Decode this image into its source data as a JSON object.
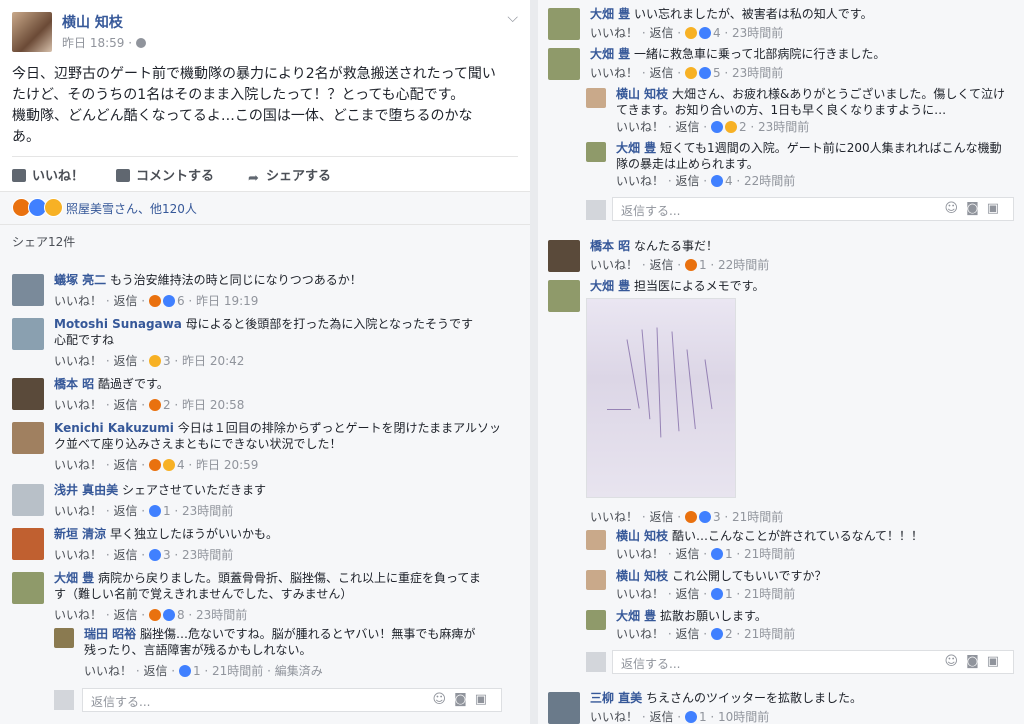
{
  "post": {
    "author": "横山 知枝",
    "time": "昨日 18:59 ·",
    "text_lines": [
      "今日、辺野古のゲート前で機動隊の暴力により2名が救急搬送されたって聞い",
      "たけど、そのうちの1名はそのまま入院したって！？とっても心配です。",
      "機動隊、どんどん酷くなってるよ…この国は一体、どこまで堕ちるのかな",
      "あ。"
    ],
    "like_label": "いいね！",
    "comment_label": "コメントする",
    "share_label": "シェアする",
    "reactions_text": "照屋美雪さん、他120人",
    "shares_text": "シェア12件"
  },
  "colors": {
    "link": "#365899",
    "meta": "#90949c",
    "like": "#4080ff",
    "sad": "#f7b125",
    "angry": "#e9710f"
  },
  "labels": {
    "like": "いいね！",
    "reply": "返信",
    "reply_placeholder": "返信する..."
  },
  "left_comments": [
    {
      "name": "蟻塚 亮二",
      "text": "もう治安維持法の時と同じになりつつあるか！",
      "count": "6",
      "time": "昨日 19:19"
    },
    {
      "name": "Motoshi Sunagawa",
      "text": "母によると後頭部を打った為に入院となったそうです",
      "text2": "心配ですね",
      "count": "3",
      "time": "昨日 20:42"
    },
    {
      "name": "橋本 昭",
      "text": "酷過ぎです。",
      "count": "2",
      "time": "昨日 20:58"
    },
    {
      "name": "Kenichi Kakuzumi",
      "text": "今日は１回目の排除からずっとゲートを閉けたままアルソッ",
      "text2": "ク並べて座り込みさえまともにできない状況でした！",
      "count": "4",
      "time": "昨日 20:59"
    },
    {
      "name": "浅井 真由美",
      "text": "シェアさせていただきます",
      "count": "1",
      "time": "23時間前"
    },
    {
      "name": "新垣 清涼",
      "text": "早く独立したほうがいいかも。",
      "count": "3",
      "time": "23時間前"
    },
    {
      "name": "大畑 豊",
      "text": "病院から戻りました。頭蓋骨骨折、脳挫傷、これ以上に重症を負ってま",
      "text2": "す（難しい名前で覚えきれませんでした、すみません）",
      "count": "8",
      "time": "23時間前"
    }
  ],
  "left_reply": {
    "name": "瑞田 昭裕",
    "text": "脳挫傷…危ないですね。脳が腫れるとヤバい！無事でも麻痺が",
    "text2": "残ったり、言語障害が残るかもしれない。",
    "count": "1",
    "time": "21時間前",
    "edited": "編集済み"
  },
  "right_comments": {
    "c1": {
      "name": "大畑 豊",
      "text": "いい忘れましたが、被害者は私の知人です。",
      "count": "4",
      "time": "23時間前"
    },
    "c2": {
      "name": "大畑 豊",
      "text": "一緒に救急車に乗って北部病院に行きました。",
      "count": "5",
      "time": "23時間前"
    },
    "r1": {
      "name": "横山 知枝",
      "text": "大畑さん、お疲れ様&ありがとうございました。傷しくて泣け",
      "text2": "てきます。お知り合いの方、1日も早く良くなりますように…",
      "count": "2",
      "time": "23時間前"
    },
    "r2": {
      "name": "大畑 豊",
      "text": "短くても1週間の入院。ゲート前に200人集まれればこんな機動",
      "text2": "隊の暴走は止められます。",
      "count": "4",
      "time": "22時間前"
    },
    "c3": {
      "name": "橋本 昭",
      "text": "なんたる事だ！",
      "count": "1",
      "time": "22時間前"
    },
    "c4": {
      "name": "大畑 豊",
      "text": "担当医によるメモです。",
      "count": "3",
      "time": "21時間前"
    },
    "r3": {
      "name": "横山 知枝",
      "text": "酷い…こんなことが許されているなんて！！！",
      "count": "1",
      "time": "21時間前"
    },
    "r4": {
      "name": "横山 知枝",
      "text": "これ公開してもいいですか？",
      "count": "1",
      "time": "21時間前"
    },
    "r5": {
      "name": "大畑 豊",
      "text": "拡散お願いします。",
      "count": "2",
      "time": "21時間前"
    },
    "c5": {
      "name": "三柳 直美",
      "text": "ちえさんのツイッターを拡散しました。",
      "count": "1",
      "time": "10時間前"
    }
  }
}
